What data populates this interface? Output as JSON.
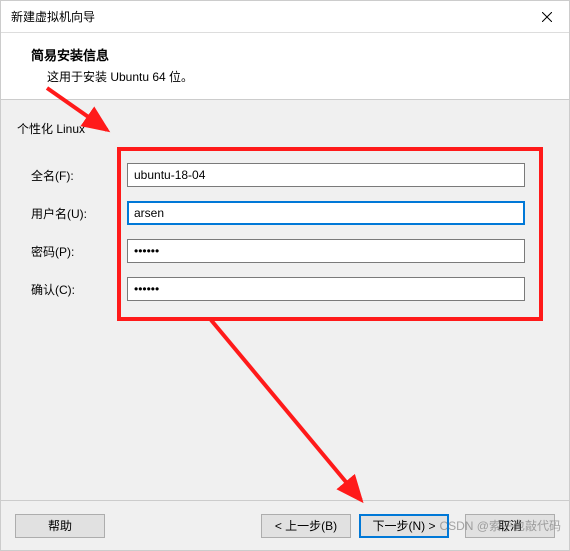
{
  "titlebar": {
    "title": "新建虚拟机向导"
  },
  "header": {
    "title": "简易安装信息",
    "subtitle": "这用于安装 Ubuntu 64 位。"
  },
  "section": {
    "label": "个性化 Linux"
  },
  "form": {
    "fullname_label": "全名(F):",
    "fullname_value": "ubuntu-18-04",
    "username_label": "用户名(U):",
    "username_value": "arsen",
    "password_label": "密码(P):",
    "password_value": "••••••",
    "confirm_label": "确认(C):",
    "confirm_value": "••••••"
  },
  "footer": {
    "help": "帮助",
    "back": "< 上一步(B)",
    "next": "下一步(N) >",
    "cancel": "取消"
  },
  "watermark": "CSDN @索子也敲代码",
  "annotation_color": "#ff1a1a"
}
